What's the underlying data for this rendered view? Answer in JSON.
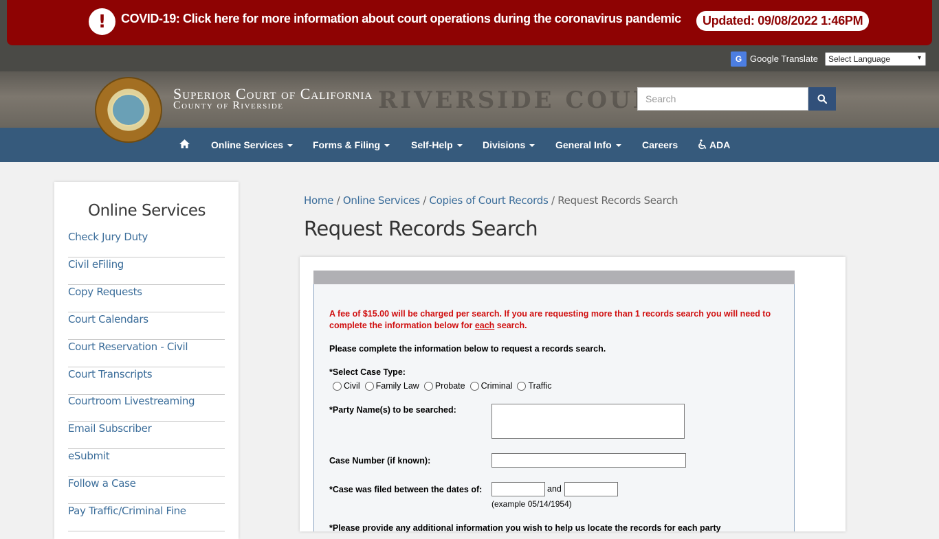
{
  "alert": {
    "icon": "exclamation-icon",
    "icon_glyph": "!",
    "message": "COVID-19: Click here for more information about court operations during the coronavirus pandemic",
    "updated": "Updated: 09/08/2022 1:46PM",
    "color": "#8e0303"
  },
  "translate": {
    "logo_glyph": "G",
    "brand": "Google Translate",
    "select_value": "Select Language"
  },
  "header": {
    "title": "Superior Court of California",
    "subtitle": "County of Riverside",
    "search_placeholder": "Search",
    "nav": {
      "home_icon": "home-icon",
      "items": [
        "Online Services",
        "Forms & Filing",
        "Self-Help",
        "Divisions",
        "General Info",
        "Careers",
        "ADA"
      ]
    },
    "nav_color": "#365a7c"
  },
  "sidebar": {
    "title": "Online Services",
    "links": [
      "Check Jury Duty",
      "Civil eFiling",
      "Copy Requests",
      "Court Calendars",
      "Court Reservation - Civil",
      "Court Transcripts",
      "Courtroom Livestreaming",
      "Email Subscriber",
      "eSubmit",
      "Follow a Case",
      "Pay Traffic/Criminal Fine"
    ]
  },
  "breadcrumb": {
    "home": "Home",
    "online_services": "Online Services",
    "copies": "Copies of Court Records",
    "current": "Request Records Search",
    "sep": "/"
  },
  "page_title": "Request Records Search",
  "form": {
    "fee_note_part1": "A fee of $15.00 will be charged per search. If you are requesting more than 1 records search you will need to complete the information below for ",
    "fee_note_each": "each",
    "fee_note_part2": " search.",
    "instructions": "Please complete the information below to request a records search.",
    "case_type_label": "*Select Case Type:",
    "case_types": [
      "Civil",
      "Family Law",
      "Probate",
      "Criminal",
      "Traffic"
    ],
    "party_label": "*Party Name(s) to be searched:",
    "case_number_label": "Case Number (if known):",
    "dates_label": "*Case was filed between the dates of:",
    "and_text": "and",
    "example": "(example 05/14/1954)",
    "cut_label": "*Please provide any additional information you wish to help us locate the records for each party"
  }
}
